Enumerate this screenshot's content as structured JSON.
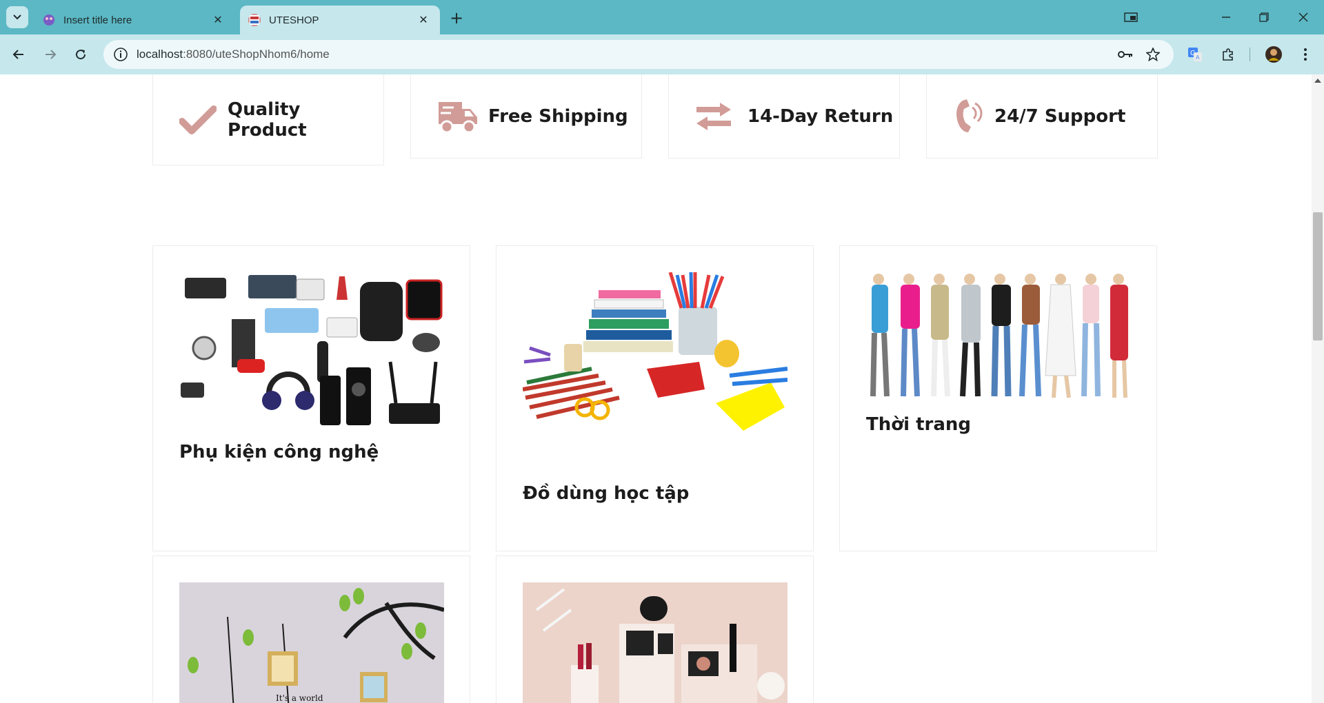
{
  "browser": {
    "tabs": [
      {
        "title": "Insert title here",
        "active": false
      },
      {
        "title": "UTESHOP",
        "active": true
      }
    ],
    "url_host": "localhost",
    "url_path": ":8080/uteShopNhom6/home",
    "colors": {
      "tabstrip": "#5bb8c4",
      "toolbar": "#c6e7ec"
    }
  },
  "features": [
    {
      "label": "Quality Product",
      "icon": "check-icon"
    },
    {
      "label": "Free Shipping",
      "icon": "truck-icon"
    },
    {
      "label": "14-Day Return",
      "icon": "exchange-icon"
    },
    {
      "label": "24/7 Support",
      "icon": "phone-icon"
    }
  ],
  "categories": [
    {
      "name": "Phụ kiện công nghệ",
      "image": "tech-accessories-image"
    },
    {
      "name": "Đồ dùng học tập",
      "image": "school-supplies-image"
    },
    {
      "name": "Thời trang",
      "image": "fashion-image"
    },
    {
      "name": "",
      "image": "wall-decor-image"
    },
    {
      "name": "",
      "image": "cosmetics-image"
    }
  ],
  "accent_color": "#d19c97"
}
